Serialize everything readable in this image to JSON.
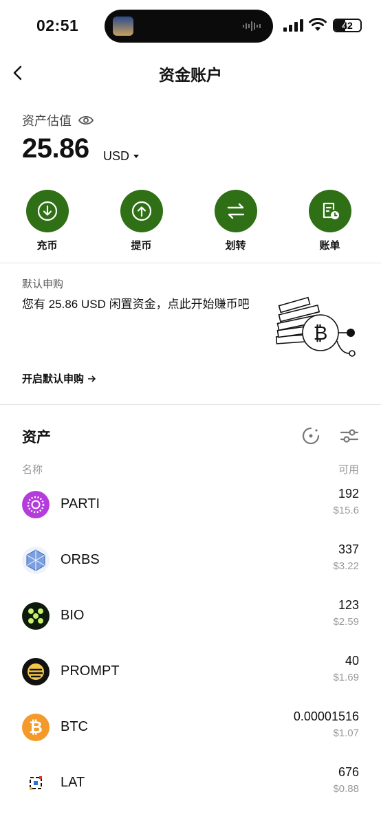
{
  "status_bar": {
    "time": "02:51",
    "battery": "42",
    "battery_level": 0.42
  },
  "header": {
    "title": "资金账户"
  },
  "estimate": {
    "label": "资产估值",
    "amount": "25.86",
    "currency": "USD"
  },
  "actions": [
    {
      "label": "充币",
      "icon": "deposit-icon"
    },
    {
      "label": "提币",
      "icon": "withdraw-icon"
    },
    {
      "label": "划转",
      "icon": "transfer-icon"
    },
    {
      "label": "账单",
      "icon": "bill-icon"
    }
  ],
  "subscribe": {
    "label": "默认申购",
    "text": "您有 25.86 USD 闲置资金，点此开始赚币吧",
    "link": "开启默认申购"
  },
  "assets": {
    "title": "资产",
    "col_name": "名称",
    "col_avail": "可用",
    "rows": [
      {
        "name": "PARTI",
        "amount": "192",
        "usd": "$15.6",
        "color": "#b53cdc"
      },
      {
        "name": "ORBS",
        "amount": "337",
        "usd": "$3.22",
        "color": "#5a7fd0"
      },
      {
        "name": "BIO",
        "amount": "123",
        "usd": "$2.59",
        "color": "#0f1a0f"
      },
      {
        "name": "PROMPT",
        "amount": "40",
        "usd": "$1.69",
        "color": "#111111"
      },
      {
        "name": "BTC",
        "amount": "0.00001516",
        "usd": "$1.07",
        "color": "#f39a2b"
      },
      {
        "name": "LAT",
        "amount": "676",
        "usd": "$0.88",
        "color": "#ffffff"
      }
    ]
  },
  "colors": {
    "accent": "#2f6f16"
  }
}
